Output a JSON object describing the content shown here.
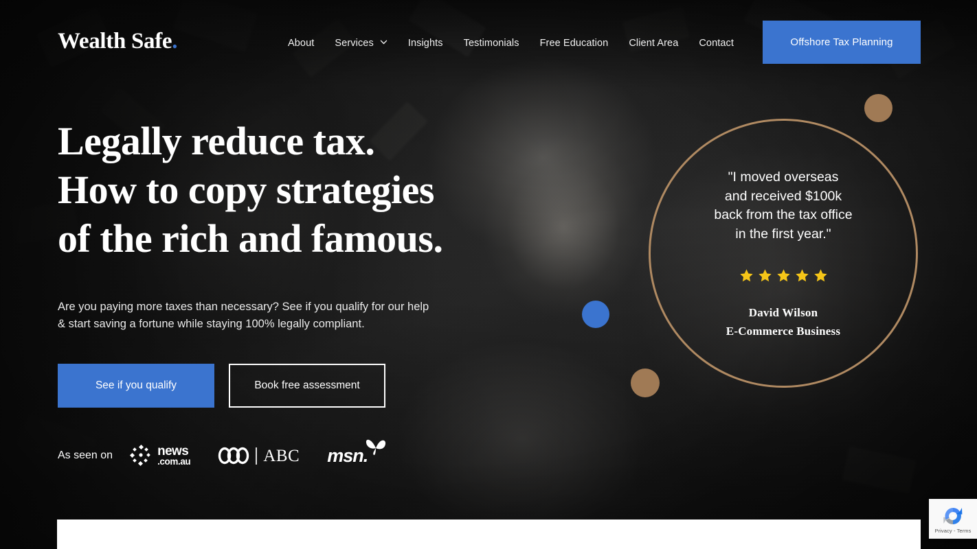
{
  "brand": {
    "logo_text": "Wealth Safe",
    "logo_dot": ".",
    "accent_blue": "#3b74cf",
    "accent_tan": "#a07a55",
    "ring_color": "#b08a62",
    "star_color": "#f5c518"
  },
  "nav": {
    "items": [
      {
        "label": "About",
        "has_dropdown": false
      },
      {
        "label": "Services",
        "has_dropdown": true
      },
      {
        "label": "Insights",
        "has_dropdown": false
      },
      {
        "label": "Testimonials",
        "has_dropdown": false
      },
      {
        "label": "Free Education",
        "has_dropdown": false
      },
      {
        "label": "Client Area",
        "has_dropdown": false
      },
      {
        "label": "Contact",
        "has_dropdown": false
      }
    ],
    "cta_label": "Offshore Tax Planning"
  },
  "hero": {
    "headline_line1": "Legally reduce tax.",
    "headline_line2": "How to copy strategies",
    "headline_line3": "of the rich and famous.",
    "subtext_line1": "Are you paying more taxes than necessary? See if you qualify for our help",
    "subtext_line2": "& start saving a fortune while staying 100% legally compliant.",
    "primary_button": "See if you qualify",
    "secondary_button": "Book free assessment"
  },
  "testimonial": {
    "quote": "\"I moved overseas\nand received $100k\nback from the tax office\nin the first year.\"",
    "rating": 5,
    "name": "David Wilson",
    "role": "E-Commerce Business"
  },
  "as_seen_on": {
    "label": "As seen on",
    "logos": [
      {
        "name": "news-com-au-logo",
        "line1": "news",
        "line2": ".com.au"
      },
      {
        "name": "abc-logo",
        "text": "ABC"
      },
      {
        "name": "msn-logo",
        "text": "msn."
      }
    ]
  },
  "recaptcha": {
    "text": "Privacy - Terms"
  }
}
